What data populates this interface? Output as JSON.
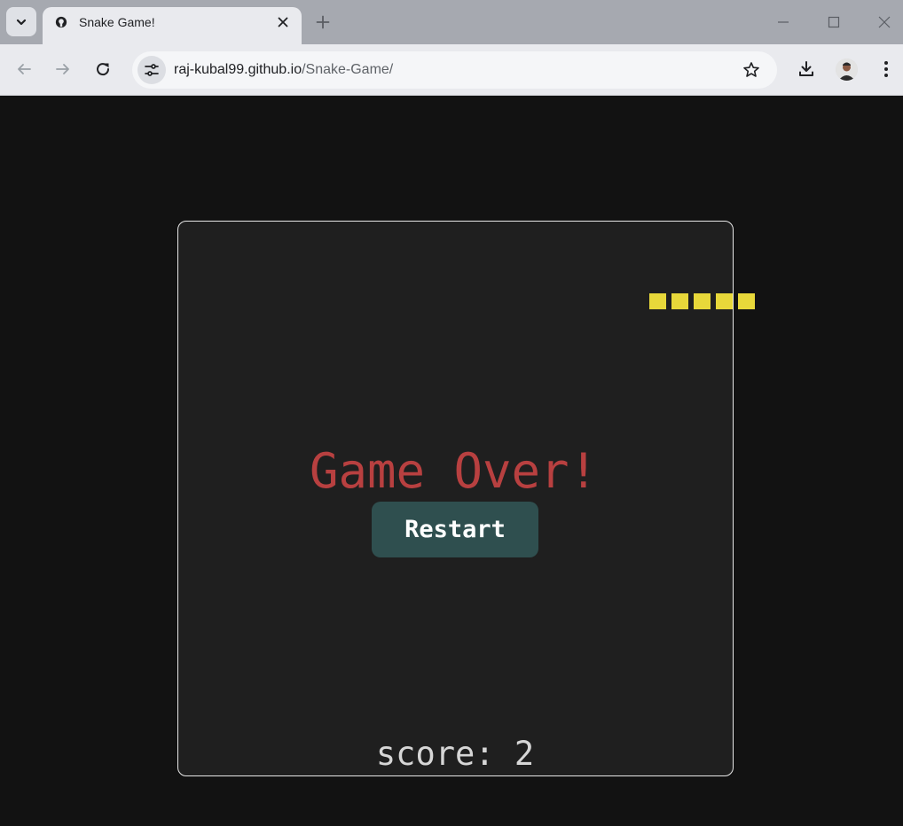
{
  "browser": {
    "tab_title": "Snake Game!",
    "url_host": "raj-kubal99.github.io",
    "url_path": "/Snake-Game/"
  },
  "icons": {
    "tab_search": "chevron-down-icon",
    "favicon": "github-icon",
    "tab_close": "close-icon",
    "new_tab": "plus-icon",
    "minimize": "minimize-icon",
    "maximize": "maximize-icon",
    "window_close": "close-icon",
    "back": "arrow-left-icon",
    "forward": "arrow-right-icon",
    "reload": "reload-icon",
    "site_info": "tune-icon",
    "bookmark": "star-icon",
    "download": "download-icon",
    "profile": "avatar",
    "menu": "kebab-menu-icon"
  },
  "game": {
    "message": "Game Over!",
    "restart_label": "Restart",
    "score_text": "score: 2",
    "snake_length": 5,
    "colors": {
      "snake": "#e8d83a",
      "message": "#b84040",
      "button": "#2f4f4f",
      "board": "#1f1f1f",
      "background": "#121212"
    }
  }
}
